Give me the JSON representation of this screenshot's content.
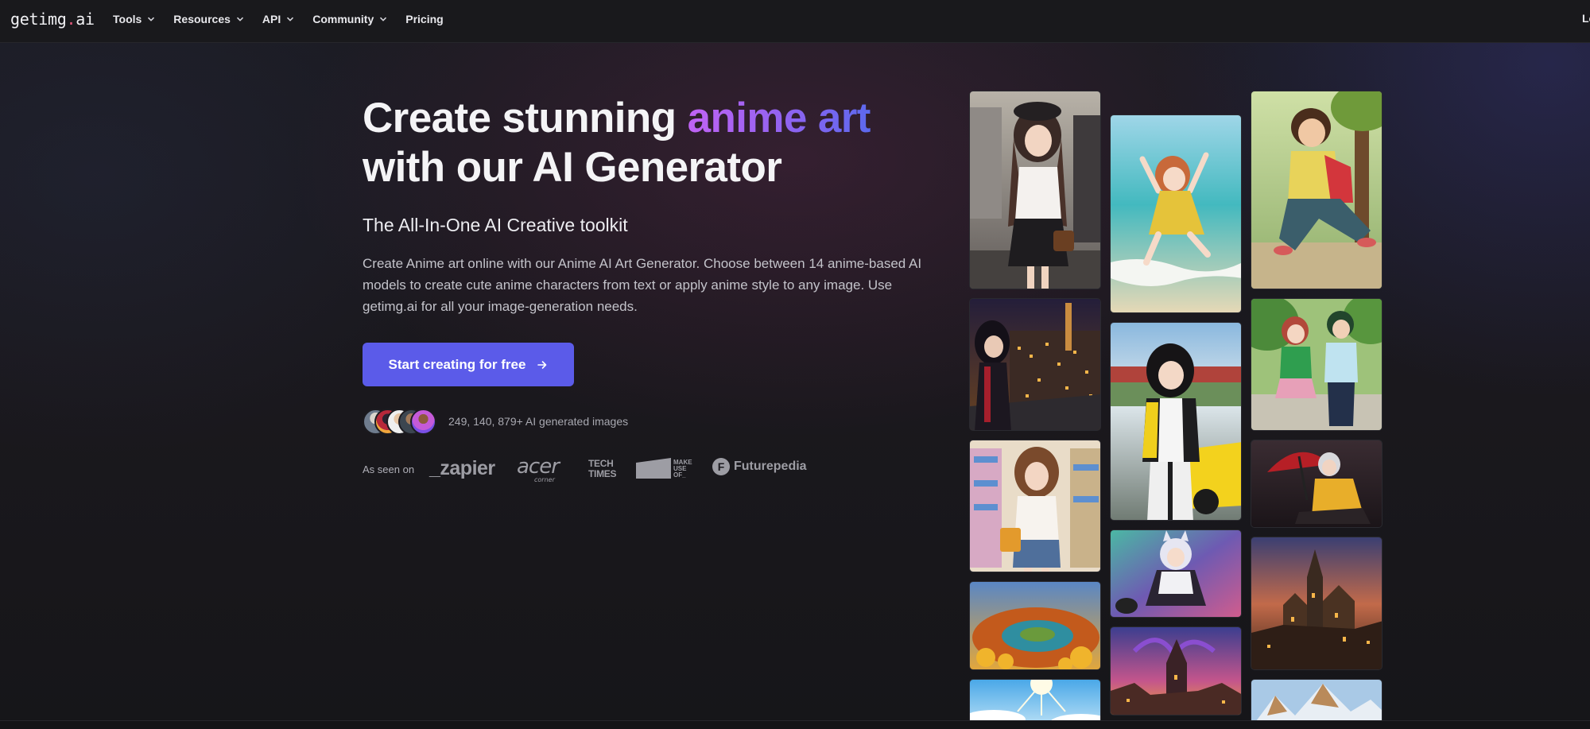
{
  "nav": {
    "logo_main": "getimg",
    "logo_dot": ".",
    "logo_tld": "ai",
    "items": [
      {
        "label": "Tools",
        "has_dropdown": true
      },
      {
        "label": "Resources",
        "has_dropdown": true
      },
      {
        "label": "API",
        "has_dropdown": true
      },
      {
        "label": "Community",
        "has_dropdown": true
      },
      {
        "label": "Pricing",
        "has_dropdown": false
      }
    ],
    "login_label": "Lo"
  },
  "hero": {
    "title_part1": "Create stunning ",
    "title_highlight": "anime art",
    "title_part2": "with our AI Generator",
    "subtitle": "The All-In-One AI Creative toolkit",
    "description": "Create Anime art online with our Anime AI Art Generator. Choose between 14 anime-based AI models to create cute anime characters from text or apply anime style to any image. Use getimg.ai for all your image-generation needs.",
    "cta_label": "Start creating for free",
    "cta_icon": "arrow-right-icon",
    "generated_count_text": "249, 140, 879+ AI generated images"
  },
  "as_seen_on": {
    "label": "As seen on",
    "brands": [
      {
        "name": "zapier",
        "text": "_zapier"
      },
      {
        "name": "acer",
        "text": "acer",
        "sub": "corner"
      },
      {
        "name": "tech-times",
        "line1": "TECH",
        "line2": "TIMES"
      },
      {
        "name": "makeuseof",
        "line1": "MAKE",
        "line2": "USE",
        "line3": "OF_"
      },
      {
        "name": "futurepedia",
        "text": "Futurepedia",
        "mark": "F"
      }
    ]
  },
  "colors": {
    "accent": "#5b5be9",
    "gradient_start": "#c063f4",
    "gradient_end": "#5c69ee",
    "logo_dot": "#e2577a",
    "background": "#17171b"
  },
  "gallery": {
    "images": [
      {
        "name": "girl-city-street",
        "alt": "Anime girl in beret on city street"
      },
      {
        "name": "girl-beach-jump",
        "alt": "Anime girl jumping at beach"
      },
      {
        "name": "boy-park",
        "alt": "Anime boy sitting in park"
      },
      {
        "name": "girl-night-city",
        "alt": "Anime girl overlooking night city"
      },
      {
        "name": "racer-girl-car",
        "alt": "Anime racer girl with yellow car"
      },
      {
        "name": "couple-walking",
        "alt": "Anime couple walking in park"
      },
      {
        "name": "girl-store",
        "alt": "Anime girl in convenience store"
      },
      {
        "name": "boy-umbrella",
        "alt": "Anime character with red umbrella"
      },
      {
        "name": "cat-girl-sky",
        "alt": "Anime cat girl in sky"
      },
      {
        "name": "castle-sunset",
        "alt": "Castle city at sunset"
      },
      {
        "name": "autumn-island",
        "alt": "Autumn landscape island"
      },
      {
        "name": "fantasy-cathedral",
        "alt": "Fantasy cathedral with tentacles"
      },
      {
        "name": "sky-sun",
        "alt": "Blue sky with sun"
      },
      {
        "name": "mountains",
        "alt": "Snowy mountains"
      }
    ]
  }
}
